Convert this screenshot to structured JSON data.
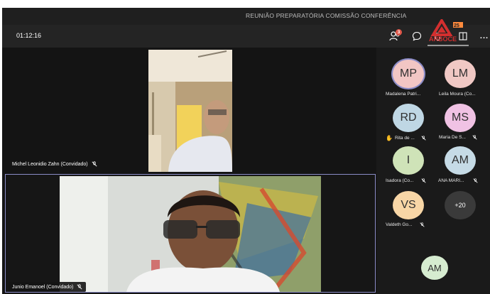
{
  "window": {
    "title": "REUNIÃO PREPARATÓRIA COMISSÃO CONFERÊNCIA"
  },
  "toolbar": {
    "timer": "01:12:16",
    "participants_count": "3",
    "icons": [
      "participants-icon",
      "chat-icon",
      "raise-hand-icon",
      "rooms-icon",
      "more-icon"
    ],
    "more_label": "..."
  },
  "watermark": {
    "text": "ARBOCE"
  },
  "videos": [
    {
      "name": "Michel Leonidio Zahn (Convidado)",
      "muted": true
    },
    {
      "name": "Junio Emanoel (Convidado)",
      "muted": true
    }
  ],
  "participants": [
    {
      "initials": "MP",
      "name": "Madalena Patri...",
      "color": "#f2c6c4",
      "selected": true,
      "muted": false,
      "hand": false
    },
    {
      "initials": "LM",
      "name": "Leila Moura (Co...",
      "color": "#f0c8c4",
      "selected": false,
      "muted": false,
      "hand": false
    },
    {
      "initials": "RD",
      "name": "Rita de ...",
      "color": "#bfd7e4",
      "selected": false,
      "muted": true,
      "hand": true
    },
    {
      "initials": "MS",
      "name": "Maria De S...",
      "color": "#f0c2e4",
      "selected": false,
      "muted": true,
      "hand": false
    },
    {
      "initials": "I",
      "name": "Isadora (Co...",
      "color": "#cfe3b8",
      "selected": false,
      "muted": true,
      "hand": false
    },
    {
      "initials": "AM",
      "name": "ANA MARI...",
      "color": "#c6dbe6",
      "selected": false,
      "muted": true,
      "hand": false
    },
    {
      "initials": "VS",
      "name": "Valdeth Go...",
      "color": "#f8d6a6",
      "selected": false,
      "muted": true,
      "hand": false
    }
  ],
  "more_participants": "+20",
  "self_view": {
    "initials": "AM",
    "color": "#d6ecd0"
  }
}
